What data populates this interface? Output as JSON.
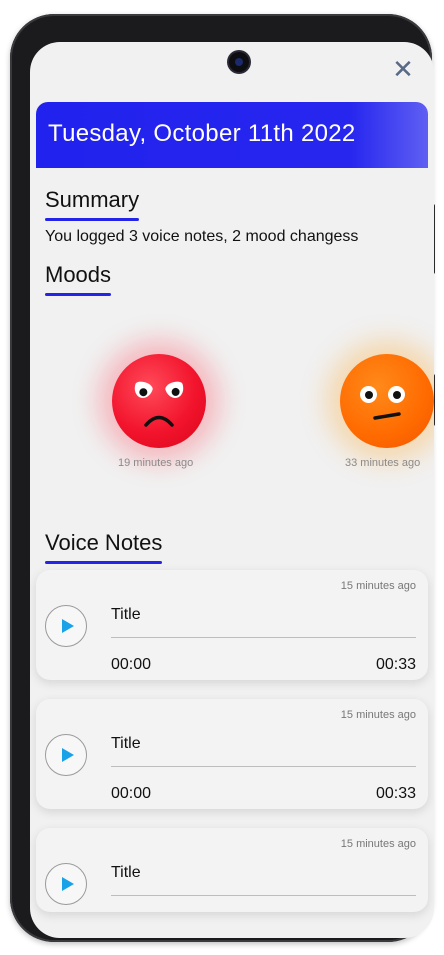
{
  "header": {
    "date": "Tuesday, October 11th 2022",
    "bg_color": "#2222ee"
  },
  "close_glyph": "✕",
  "summary": {
    "title": "Summary",
    "text": "You logged 3 voice notes, 2 mood changess"
  },
  "moods": {
    "title": "Moods",
    "items": [
      {
        "mood": "angry",
        "color": "#f2142c",
        "time": "19 minutes ago"
      },
      {
        "mood": "neutral",
        "color": "#ff6a00",
        "time": "33 minutes ago"
      }
    ]
  },
  "voice_notes": {
    "title": "Voice Notes",
    "items": [
      {
        "ago": "15 minutes ago",
        "title": "Title",
        "start": "00:00",
        "end": "00:33",
        "progress": 0
      },
      {
        "ago": "15 minutes ago",
        "title": "Title",
        "start": "00:00",
        "end": "00:33",
        "progress": 0
      },
      {
        "ago": "15 minutes ago",
        "title": "Title"
      }
    ]
  },
  "accent_color": "#2424e8",
  "play_color": "#1aa2e8"
}
